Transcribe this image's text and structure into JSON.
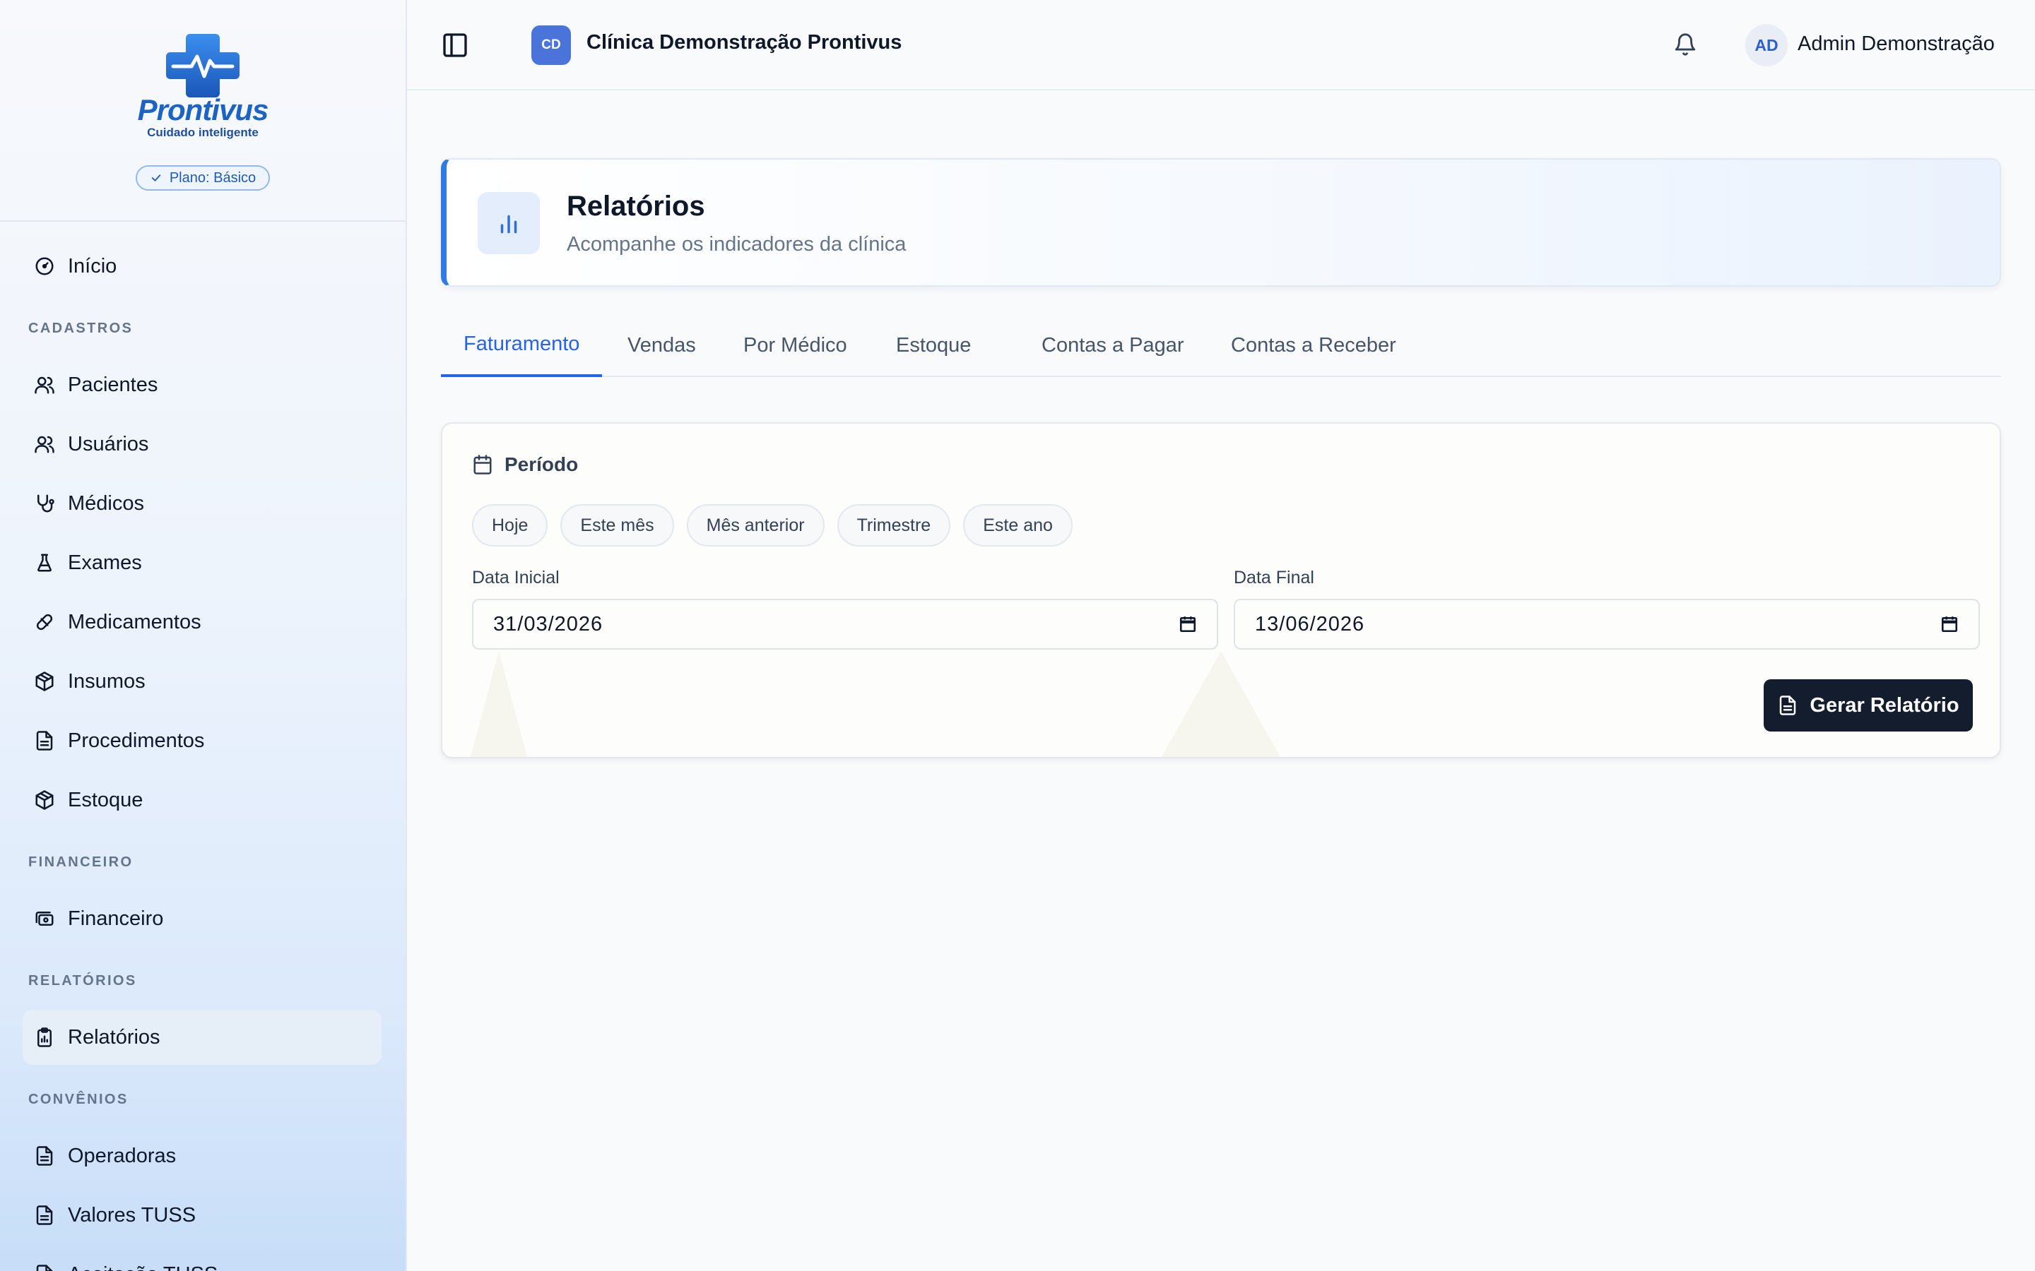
{
  "sidebar": {
    "logo": {
      "wordmark": "Prontivus",
      "tagline": "Cuidado inteligente"
    },
    "plan_badge": "Plano: Básico",
    "items": [
      {
        "label": "Início",
        "icon": "gauge-icon"
      },
      {
        "section": "CADASTROS"
      },
      {
        "label": "Pacientes",
        "icon": "users-icon"
      },
      {
        "label": "Usuários",
        "icon": "users-icon"
      },
      {
        "label": "Médicos",
        "icon": "stethoscope-icon"
      },
      {
        "label": "Exames",
        "icon": "flask-icon"
      },
      {
        "label": "Medicamentos",
        "icon": "pill-icon"
      },
      {
        "label": "Insumos",
        "icon": "package-icon"
      },
      {
        "label": "Procedimentos",
        "icon": "file-text-icon"
      },
      {
        "label": "Estoque",
        "icon": "package-icon"
      },
      {
        "section": "FINANCEIRO"
      },
      {
        "label": "Financeiro",
        "icon": "banknote-icon"
      },
      {
        "section": "RELATÓRIOS"
      },
      {
        "label": "Relatórios",
        "icon": "clipboard-chart-icon",
        "active": true
      },
      {
        "section": "CONVÊNIOS"
      },
      {
        "label": "Operadoras",
        "icon": "file-text-icon"
      },
      {
        "label": "Valores TUSS",
        "icon": "file-text-icon"
      },
      {
        "label": "Aceitação TUSS",
        "icon": "file-text-icon"
      }
    ]
  },
  "topbar": {
    "clinic_initials": "CD",
    "clinic_name": "Clínica Demonstração Prontivus",
    "user_initials": "AD",
    "user_name": "Admin Demonstração"
  },
  "header": {
    "title": "Relatórios",
    "subtitle": "Acompanhe os indicadores da clínica"
  },
  "tabs": [
    {
      "label": "Faturamento",
      "active": true
    },
    {
      "label": "Vendas"
    },
    {
      "label": "Por Médico"
    },
    {
      "label": "Estoque"
    },
    {
      "label": "Contas a Pagar"
    },
    {
      "label": "Contas a Receber"
    }
  ],
  "period": {
    "title": "Período",
    "chips": [
      "Hoje",
      "Este mês",
      "Mês anterior",
      "Trimestre",
      "Este ano"
    ],
    "start_label": "Data Inicial",
    "start_value": "31/03/2026",
    "end_label": "Data Final",
    "end_value": "13/06/2026",
    "generate_label": "Gerar Relatório"
  },
  "colors": {
    "accent": "#2563eb",
    "header_border": "#2f7ae5",
    "button_bg": "#131d2e",
    "clinic_avatar": "#4a74d9"
  }
}
